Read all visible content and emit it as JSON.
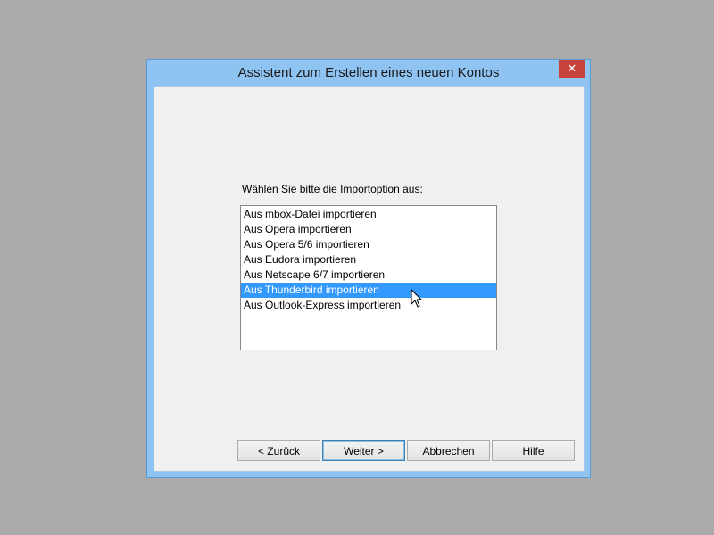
{
  "window": {
    "title": "Assistent zum Erstellen eines neuen Kontos",
    "close_symbol": "✕"
  },
  "main": {
    "prompt": "Wählen Sie bitte die Importoption aus:",
    "options": [
      {
        "label": "Aus mbox-Datei importieren",
        "selected": false
      },
      {
        "label": "Aus Opera importieren",
        "selected": false
      },
      {
        "label": "Aus Opera 5/6 importieren",
        "selected": false
      },
      {
        "label": "Aus Eudora importieren",
        "selected": false
      },
      {
        "label": "Aus Netscape 6/7 importieren",
        "selected": false
      },
      {
        "label": "Aus Thunderbird importieren",
        "selected": true
      },
      {
        "label": "Aus Outlook-Express importieren",
        "selected": false
      }
    ]
  },
  "buttons": {
    "back": "< Zurück",
    "next": "Weiter >",
    "cancel": "Abbrechen",
    "help": "Hilfe"
  },
  "colors": {
    "desktop": "#ababab",
    "frame": "#8ec3f2",
    "close": "#c8423c",
    "selection": "#3399ff"
  },
  "icons": {
    "close": "close-icon",
    "cursor": "mouse-pointer-icon"
  }
}
